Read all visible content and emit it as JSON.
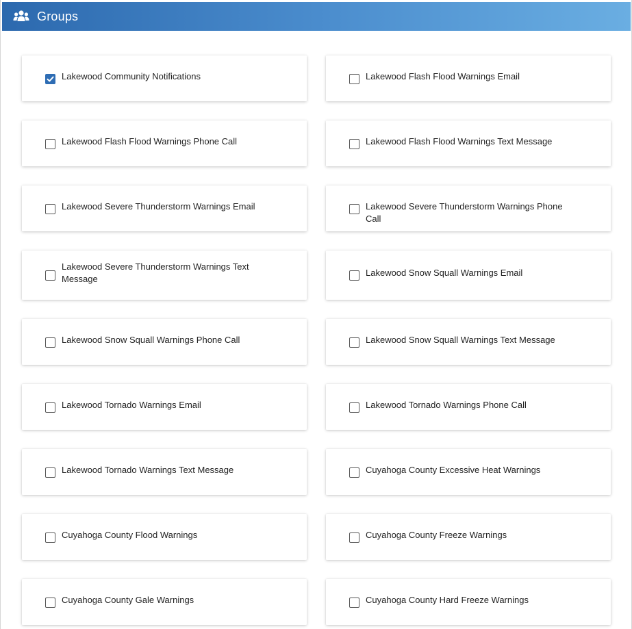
{
  "header": {
    "title": "Groups",
    "icon": "users-group-icon"
  },
  "colors": {
    "header_start": "#2c69ae",
    "header_end": "#6aaee2",
    "checkbox_checked": "#2e6db4"
  },
  "groups": [
    {
      "label": "Lakewood Community Notifications",
      "checked": true
    },
    {
      "label": "Lakewood Flash Flood Warnings Email",
      "checked": false
    },
    {
      "label": "Lakewood Flash Flood Warnings Phone Call",
      "checked": false
    },
    {
      "label": "Lakewood Flash Flood Warnings Text Message",
      "checked": false
    },
    {
      "label": "Lakewood Severe Thunderstorm Warnings Email",
      "checked": false
    },
    {
      "label": "Lakewood Severe Thunderstorm Warnings Phone Call",
      "checked": false
    },
    {
      "label": "Lakewood Severe Thunderstorm Warnings Text Message",
      "checked": false
    },
    {
      "label": "Lakewood Snow Squall Warnings Email",
      "checked": false
    },
    {
      "label": "Lakewood Snow Squall Warnings Phone Call",
      "checked": false
    },
    {
      "label": "Lakewood Snow Squall Warnings Text Message",
      "checked": false
    },
    {
      "label": "Lakewood Tornado Warnings Email",
      "checked": false
    },
    {
      "label": "Lakewood Tornado Warnings Phone Call",
      "checked": false
    },
    {
      "label": "Lakewood Tornado Warnings Text Message",
      "checked": false
    },
    {
      "label": "Cuyahoga County Excessive Heat Warnings",
      "checked": false
    },
    {
      "label": "Cuyahoga County Flood Warnings",
      "checked": false
    },
    {
      "label": "Cuyahoga County Freeze Warnings",
      "checked": false
    },
    {
      "label": "Cuyahoga County Gale Warnings",
      "checked": false
    },
    {
      "label": "Cuyahoga County Hard Freeze Warnings",
      "checked": false
    }
  ]
}
